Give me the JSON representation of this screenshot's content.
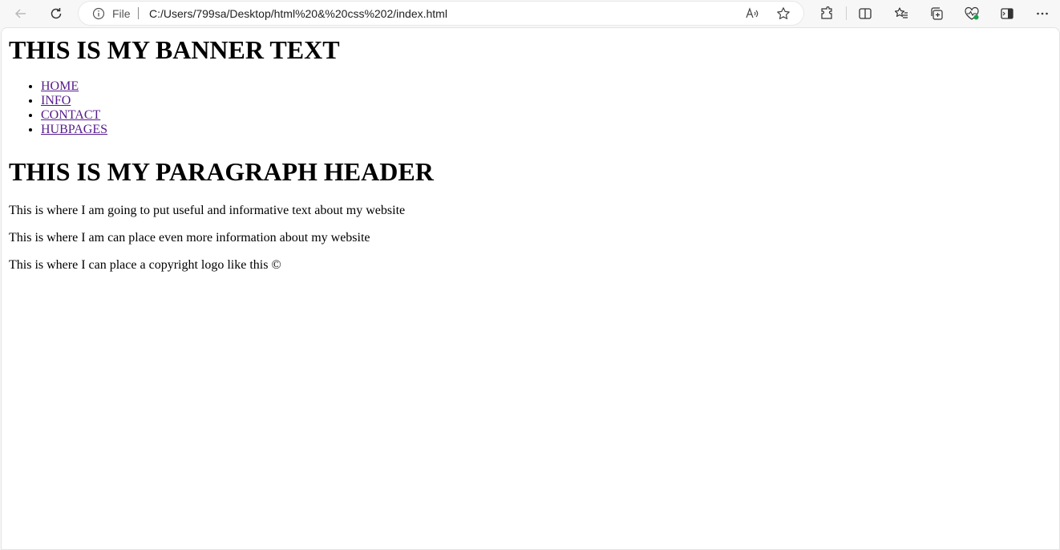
{
  "browser": {
    "address_scheme": "File",
    "address_url": "C:/Users/799sa/Desktop/html%20&%20css%202/index.html"
  },
  "page": {
    "banner": "THIS IS MY BANNER TEXT",
    "nav": [
      {
        "label": "HOME"
      },
      {
        "label": "INFO"
      },
      {
        "label": "CONTACT"
      },
      {
        "label": "HUBPAGES"
      }
    ],
    "paragraph_header": "THIS IS MY PARAGRAPH HEADER",
    "paragraphs": [
      "This is where I am going to put useful and informative text about my website",
      "This is where I am can place even more information about my website",
      "This is where I can place a copyright logo like this ©"
    ]
  },
  "colors": {
    "link_visited": "#551a8b",
    "toolbar_bg": "#f7f7f7"
  },
  "icons": [
    "back-icon",
    "refresh-icon",
    "info-icon",
    "read-aloud-icon",
    "favorite-star-icon",
    "extensions-icon",
    "split-screen-icon",
    "favorites-icon",
    "collections-icon",
    "browser-essentials-icon",
    "sidebar-icon",
    "more-icon"
  ]
}
